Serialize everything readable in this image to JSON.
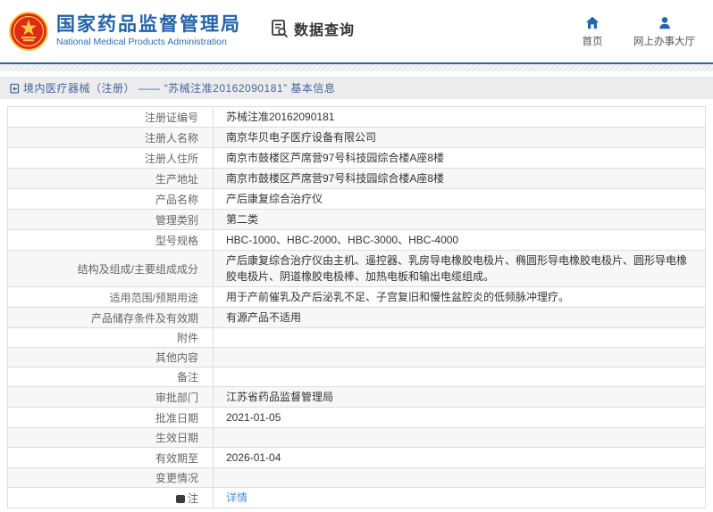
{
  "colors": {
    "brand_blue": "#2563a8",
    "icon_blue": "#1f66b1",
    "link_blue": "#4a90d9",
    "breadcrumb_text": "#44639e",
    "emblem_red": "#de2a18",
    "emblem_gold": "#f7c948",
    "header_rule_blue": "#2a6496",
    "alt_row_bg": "#f7f7f7"
  },
  "header": {
    "title": "国家药品监督管理局",
    "subtitle": "National Medical Products Administration",
    "section_label": "数据查询",
    "nav": [
      {
        "label": "首页",
        "icon": "home-icon"
      },
      {
        "label": "网上办事大厅",
        "icon": "person-icon"
      }
    ]
  },
  "breadcrumb": {
    "text": "境内医疗器械（注册） —— “苏械注准20162090181” 基本信息"
  },
  "table": {
    "rows": [
      {
        "label": "注册证编号",
        "value": "苏械注准20162090181"
      },
      {
        "label": "注册人名称",
        "value": "南京华贝电子医疗设备有限公司"
      },
      {
        "label": "注册人住所",
        "value": "南京市鼓楼区芦席营97号科技园综合楼A座8楼"
      },
      {
        "label": "生产地址",
        "value": "南京市鼓楼区芦席营97号科技园综合楼A座8楼"
      },
      {
        "label": "产品名称",
        "value": "产后康复综合治疗仪"
      },
      {
        "label": "管理类别",
        "value": "第二类"
      },
      {
        "label": "型号规格",
        "value": "HBC-1000、HBC-2000、HBC-3000、HBC-4000"
      },
      {
        "label": "结构及组成/主要组成成分",
        "value": "产后康复综合治疗仪由主机、遥控器、乳房导电橡胶电极片、椭圆形导电橡胶电极片、圆形导电橡胶电极片、阴道橡胶电极棒、加热电板和输出电缆组成。",
        "multiline": true
      },
      {
        "label": "适用范围/预期用途",
        "value": "用于产前催乳及产后泌乳不足、子宫复旧和慢性盆腔炎的低频脉冲理疗。"
      },
      {
        "label": "产品储存条件及有效期",
        "value": "有源产品不适用"
      },
      {
        "label": "附件",
        "value": ""
      },
      {
        "label": "其他内容",
        "value": ""
      },
      {
        "label": "备注",
        "value": ""
      },
      {
        "label": "审批部门",
        "value": "江苏省药品监督管理局"
      },
      {
        "label": "批准日期",
        "value": "2021-01-05"
      },
      {
        "label": "生效日期",
        "value": ""
      },
      {
        "label": "有效期至",
        "value": "2026-01-04"
      },
      {
        "label": "变更情况",
        "value": ""
      },
      {
        "label": "注",
        "value": "详情",
        "label_icon": "note-bubble-icon",
        "link": true
      }
    ]
  }
}
